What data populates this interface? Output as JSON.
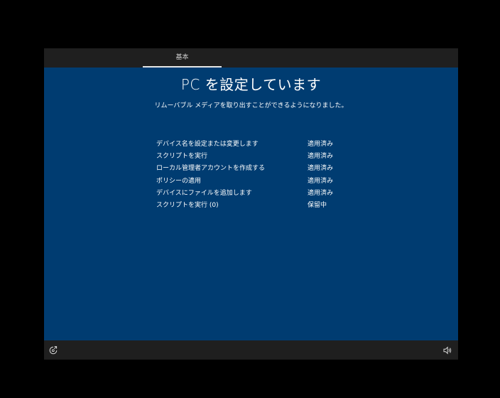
{
  "tabs": [
    {
      "label": "基本",
      "active": true
    }
  ],
  "main": {
    "title": "PC を設定しています",
    "subtitle": "リムーバブル メディアを取り出すことができるようになりました。",
    "steps": [
      {
        "label": "デバイス名を設定または変更します",
        "status": "適用済み"
      },
      {
        "label": "スクリプトを実行",
        "status": "適用済み"
      },
      {
        "label": "ローカル管理者アカウントを作成する",
        "status": "適用済み"
      },
      {
        "label": "ポリシーの適用",
        "status": "適用済み"
      },
      {
        "label": "デバイスにファイルを追加します",
        "status": "適用済み"
      },
      {
        "label": "スクリプトを実行 (0)",
        "status": "保留中"
      }
    ]
  },
  "bottombar": {
    "left_icon": "ease-of-access-icon",
    "right_icon": "volume-icon"
  },
  "colors": {
    "background": "#000000",
    "bar": "#1f1f1f",
    "content": "#003c71",
    "text": "#ffffff"
  }
}
